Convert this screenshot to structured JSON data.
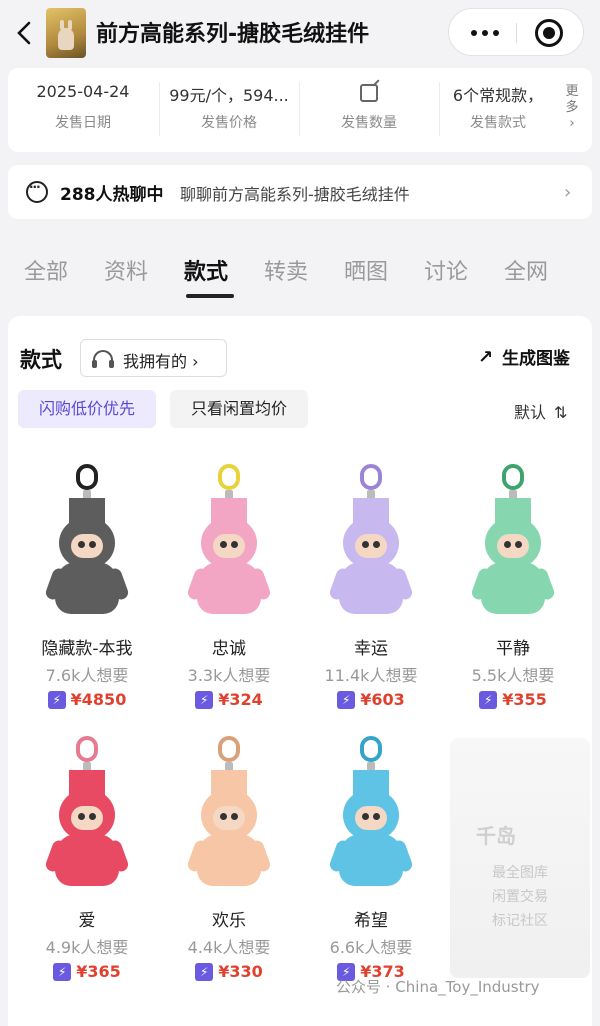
{
  "header": {
    "title": "前方高能系列-搪胶毛绒挂件"
  },
  "info": [
    {
      "value": "2025-04-24",
      "label": "发售日期"
    },
    {
      "value": "99元/个，594...",
      "label": "发售价格"
    },
    {
      "value": "",
      "label": "发售数量"
    },
    {
      "value": "6个常规款，",
      "label": "发售款式"
    }
  ],
  "more_label": "更多",
  "chat": {
    "count": "288人热聊中",
    "text": "聊聊前方高能系列-搪胶毛绒挂件"
  },
  "tabs": [
    "全部",
    "资料",
    "款式",
    "转卖",
    "晒图",
    "讨论",
    "全网"
  ],
  "active_tab": "款式",
  "section": {
    "title": "款式",
    "own_label": "我拥有的 ›",
    "generate_label": "生成图鉴",
    "filter_flash": "闪购低价优先",
    "filter_idle": "只看闲置均价",
    "sort_label": "默认",
    "sort_icon": "⇅"
  },
  "items": [
    {
      "name": "隐藏款-本我",
      "want": "7.6k人想要",
      "price": "¥4850",
      "color": "#5d5d5d",
      "ring": "#222222"
    },
    {
      "name": "忠诚",
      "want": "3.3k人想要",
      "price": "¥324",
      "color": "#f3a6c3",
      "ring": "#e8d23a"
    },
    {
      "name": "幸运",
      "want": "11.4k人想要",
      "price": "¥603",
      "color": "#c7b8f0",
      "ring": "#9b83d6"
    },
    {
      "name": "平静",
      "want": "5.5k人想要",
      "price": "¥355",
      "color": "#86d7b0",
      "ring": "#3fa36d"
    },
    {
      "name": "爱",
      "want": "4.9k人想要",
      "price": "¥365",
      "color": "#e84a63",
      "ring": "#e77a90"
    },
    {
      "name": "欢乐",
      "want": "4.4k人想要",
      "price": "¥330",
      "color": "#f7c6a6",
      "ring": "#d9a07a"
    },
    {
      "name": "希望",
      "want": "6.6k人想要",
      "price": "¥373",
      "color": "#5fc3e6",
      "ring": "#35a4c9"
    }
  ],
  "watermark": {
    "logo": "千岛",
    "lines": [
      "最全图库",
      "闲置交易",
      "标记社区"
    ]
  },
  "footer": "公众号 · China_Toy_Industry"
}
